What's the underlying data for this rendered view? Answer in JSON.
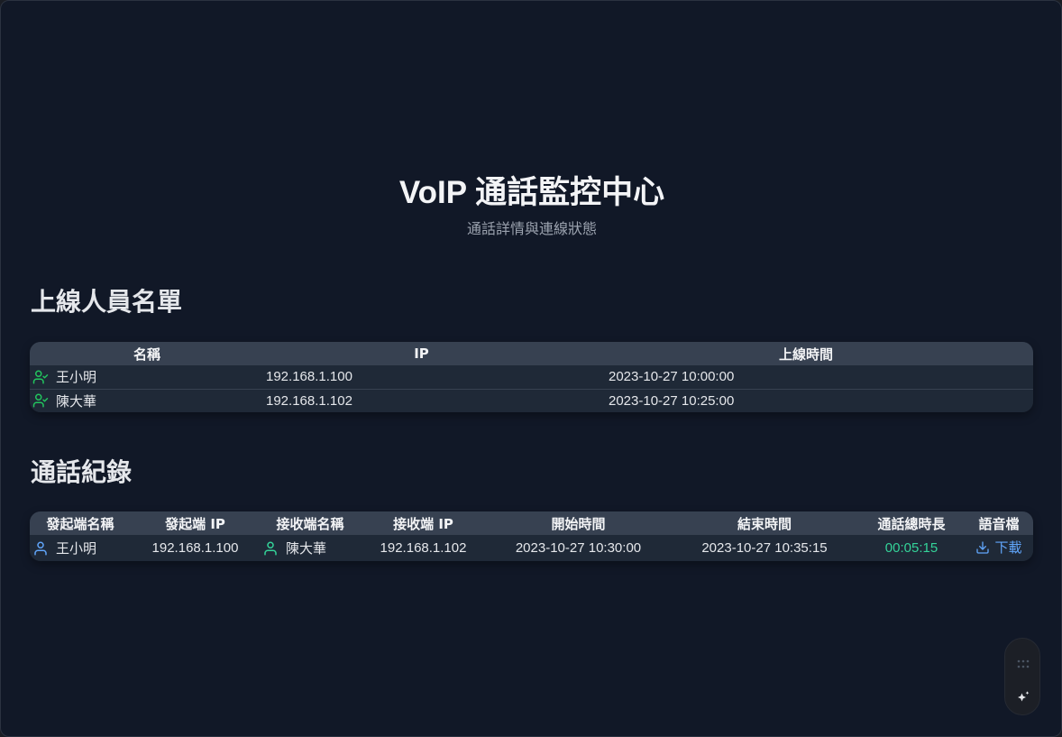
{
  "header": {
    "title": "VoIP 通話監控中心",
    "subtitle": "通話詳情與連線狀態"
  },
  "online_users": {
    "section_title": "上線人員名單",
    "columns": [
      "名稱",
      "IP",
      "上線時間"
    ],
    "rows": [
      {
        "name": "王小明",
        "ip": "192.168.1.100",
        "time": "2023-10-27 10:00:00",
        "icon": "user-check-icon"
      },
      {
        "name": "陳大華",
        "ip": "192.168.1.102",
        "time": "2023-10-27 10:25:00",
        "icon": "user-check-icon"
      }
    ]
  },
  "call_log": {
    "section_title": "通話紀錄",
    "columns": [
      "發起端名稱",
      "發起端 IP",
      "接收端名稱",
      "接收端 IP",
      "開始時間",
      "結束時間",
      "通話總時長",
      "語音檔"
    ],
    "rows": [
      {
        "caller_name": "王小明",
        "caller_ip": "192.168.1.100",
        "callee_name": "陳大華",
        "callee_ip": "192.168.1.102",
        "start": "2023-10-27 10:30:00",
        "end": "2023-10-27 10:35:15",
        "duration": "00:05:15",
        "download_label": "下載"
      }
    ]
  },
  "colors": {
    "background": "#111827",
    "table_header": "#374151",
    "table_body": "#1f2937",
    "online_icon": "#22c55e",
    "caller_icon": "#60a5fa",
    "callee_icon": "#34d399",
    "duration": "#34d399",
    "link": "#60a5fa"
  },
  "floating_toolbar": {
    "icons": [
      "drag-grip-icon",
      "sparkle-icon"
    ]
  }
}
